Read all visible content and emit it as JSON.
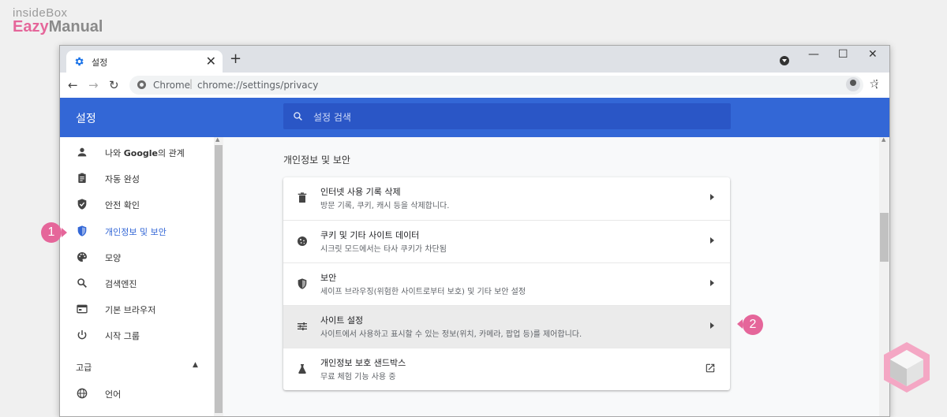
{
  "logo": {
    "line1": "insideBox",
    "line2_highlight": "Eazy",
    "line2_rest": "Manual"
  },
  "browser": {
    "tab_title": "설정",
    "tab_close": "✕",
    "new_tab": "+",
    "win_min": "—",
    "win_max": "☐",
    "win_close": "✕",
    "omnibox": {
      "site": "Chrome",
      "separator": "|",
      "url": "chrome://settings/privacy"
    }
  },
  "header": {
    "title": "설정",
    "search_placeholder": "설정 검색"
  },
  "sidebar": {
    "items": [
      {
        "label_pre": "나와 ",
        "label_bold": "Google",
        "label_post": "의 관계",
        "icon": "person-icon"
      },
      {
        "label": "자동 완성",
        "icon": "clipboard-icon"
      },
      {
        "label": "안전 확인",
        "icon": "shield-check-icon"
      },
      {
        "label": "개인정보 및 보안",
        "icon": "shield-icon",
        "active": true
      },
      {
        "label": "모양",
        "icon": "palette-icon"
      },
      {
        "label": "검색엔진",
        "icon": "search-icon"
      },
      {
        "label": "기본 브라우저",
        "icon": "browser-icon"
      },
      {
        "label": "시작 그룹",
        "icon": "power-icon"
      }
    ],
    "advanced_label": "고급",
    "language_label": "언어"
  },
  "main": {
    "section_title": "개인정보 및 보안",
    "rows": [
      {
        "title": "인터넷 사용 기록 삭제",
        "subtitle": "방문 기록, 쿠키, 캐시 등을 삭제합니다.",
        "icon": "trash-icon"
      },
      {
        "title": "쿠키 및 기타 사이트 데이터",
        "subtitle": "시크릿 모드에서는 타사 쿠키가 차단됨",
        "icon": "cookie-icon"
      },
      {
        "title": "보안",
        "subtitle": "세이프 브라우징(위험한 사이트로부터 보호) 및 기타 보안 설정",
        "icon": "shield-icon"
      },
      {
        "title": "사이트 설정",
        "subtitle": "사이트에서 사용하고 표시할 수 있는 정보(위치, 카메라, 팝업 등)를 제어합니다.",
        "icon": "tune-icon",
        "highlighted": true
      },
      {
        "title": "개인정보 보호 샌드박스",
        "subtitle": "무료 체험 기능 사용 중",
        "icon": "flask-icon"
      }
    ]
  },
  "annotations": {
    "badge1": "1",
    "badge2": "2",
    "badge_color": "#e5669a"
  },
  "colors": {
    "header_bg": "#3367d6",
    "search_bg": "#2a56c6",
    "accent": "#3367d6"
  }
}
